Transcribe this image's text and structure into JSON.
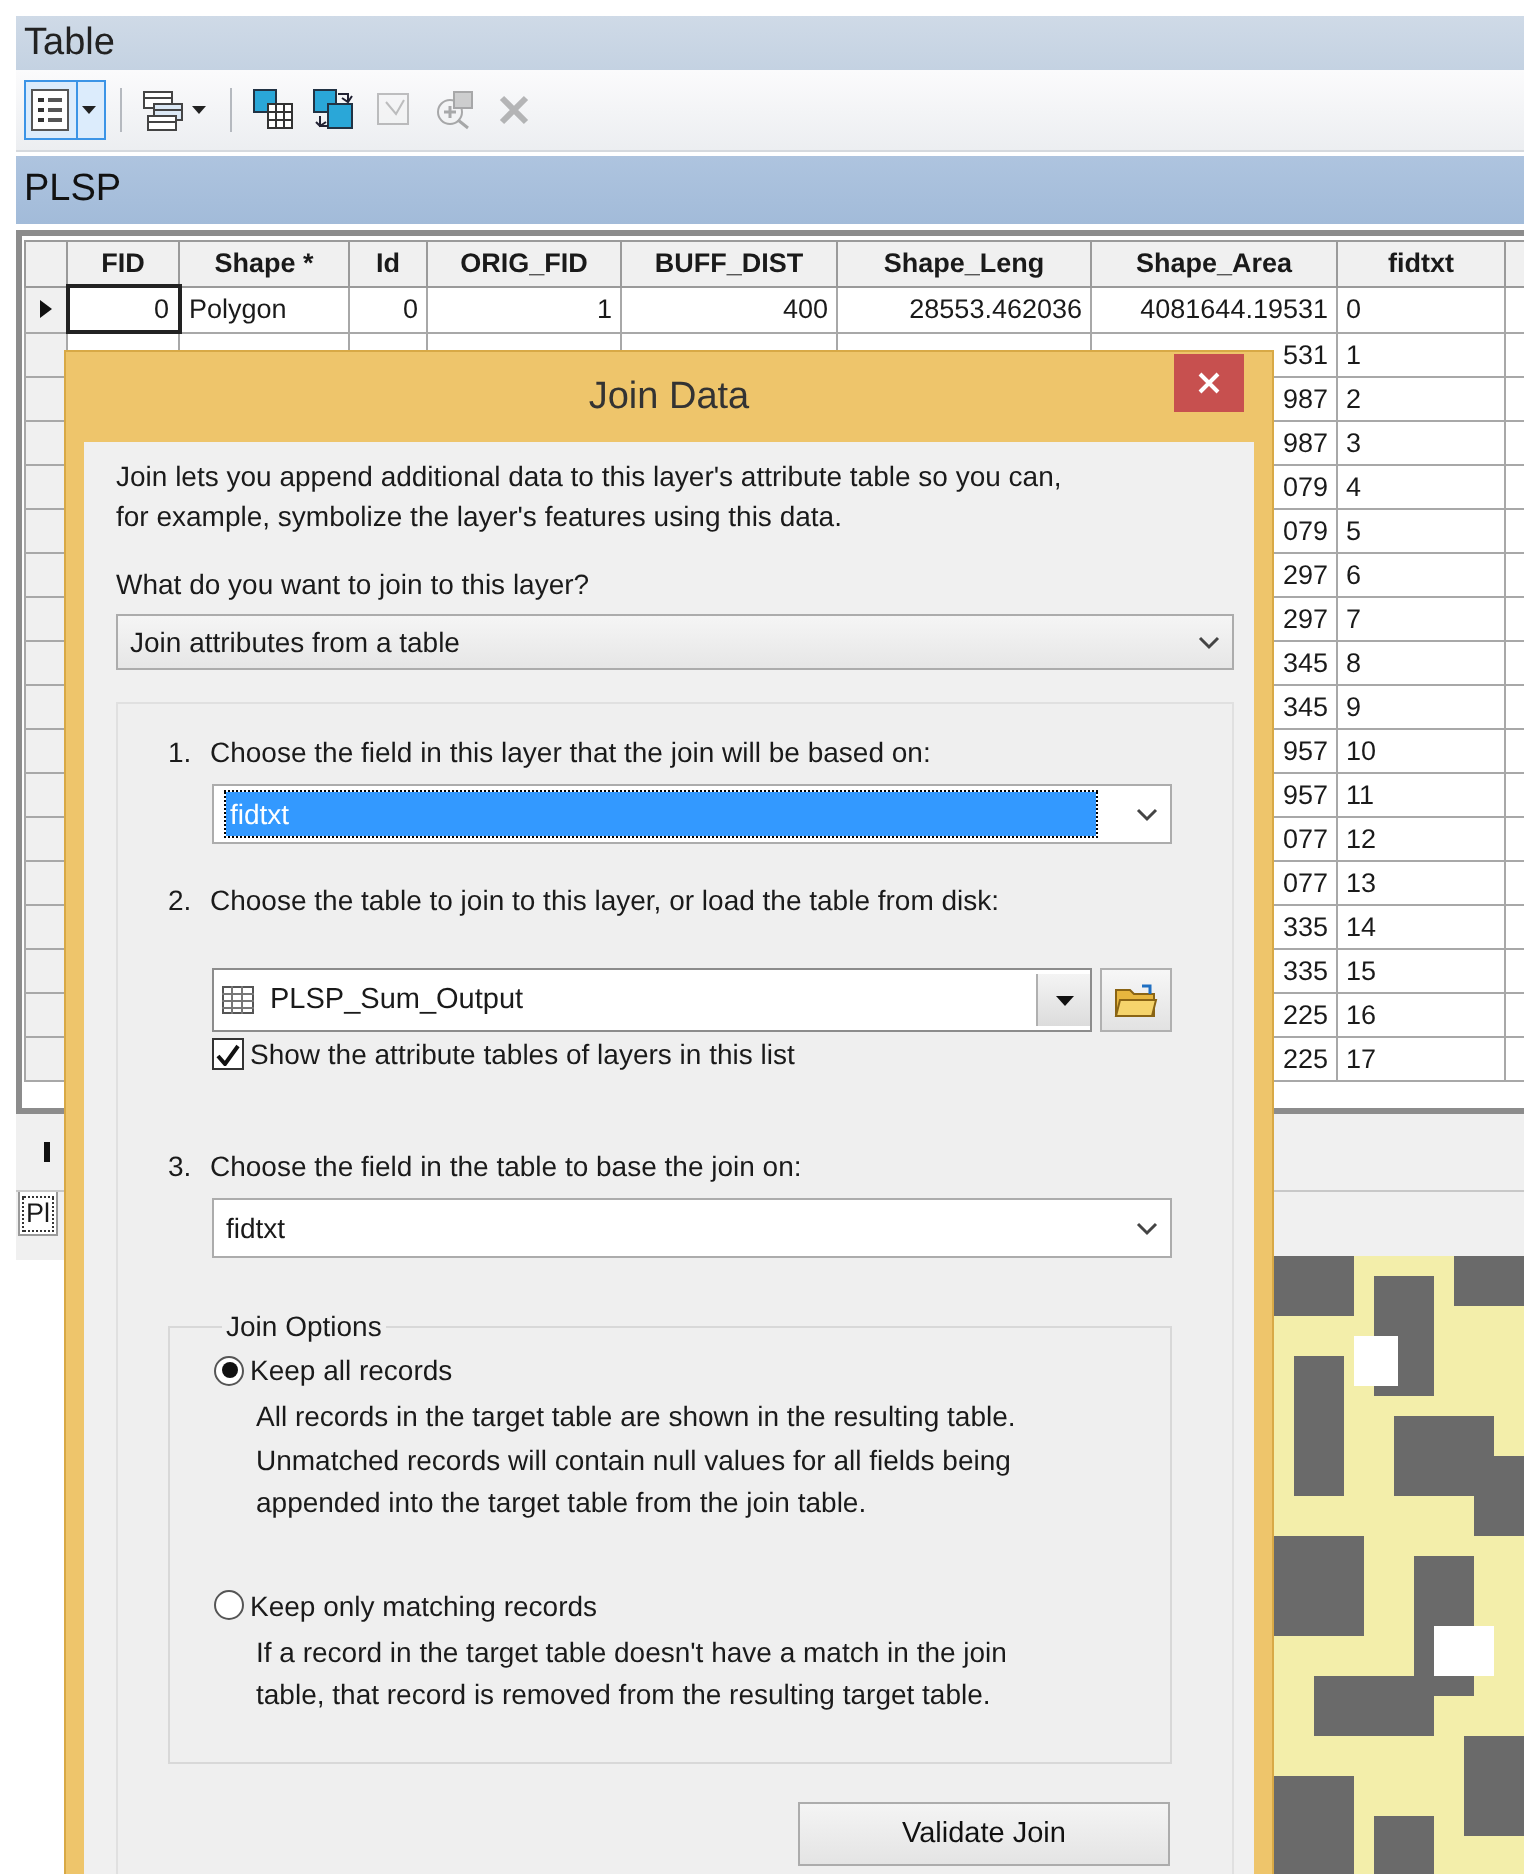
{
  "window": {
    "title": "Table"
  },
  "toolbar": [
    {
      "kind": "table-options",
      "dropdown": true,
      "selected": true,
      "disabled": false
    },
    {
      "kind": "relate",
      "dropdown": true,
      "selected": false,
      "disabled": false
    },
    {
      "kind": "select-by",
      "dropdown": false,
      "selected": false,
      "disabled": false
    },
    {
      "kind": "switch-selection",
      "dropdown": false,
      "selected": false,
      "disabled": false
    },
    {
      "kind": "clear-selection",
      "dropdown": false,
      "selected": false,
      "disabled": true
    },
    {
      "kind": "zoom-selected",
      "dropdown": false,
      "selected": false,
      "disabled": true
    },
    {
      "kind": "delete",
      "dropdown": false,
      "selected": false,
      "disabled": true
    }
  ],
  "layer_title": "PLSP",
  "table": {
    "columns": [
      {
        "name": "FID",
        "kind": "number"
      },
      {
        "name": "Shape *",
        "kind": "text"
      },
      {
        "name": "Id",
        "kind": "number"
      },
      {
        "name": "ORIG_FID",
        "kind": "number"
      },
      {
        "name": "BUFF_DIST",
        "kind": "number"
      },
      {
        "name": "Shape_Leng",
        "kind": "number"
      },
      {
        "name": "Shape_Area",
        "kind": "number"
      },
      {
        "name": "fidtxt",
        "kind": "text"
      }
    ],
    "rows": [
      {
        "current": true,
        "cells": [
          "0",
          "Polygon",
          "0",
          "1",
          "400",
          "28553.462036",
          "4081644.19531",
          "0"
        ]
      },
      {
        "current": false,
        "shape_area": "531",
        "fidtxt": "1"
      },
      {
        "current": false,
        "shape_area": "987",
        "fidtxt": "2"
      },
      {
        "current": false,
        "shape_area": "987",
        "fidtxt": "3"
      },
      {
        "current": false,
        "shape_area": "079",
        "fidtxt": "4"
      },
      {
        "current": false,
        "shape_area": "079",
        "fidtxt": "5"
      },
      {
        "current": false,
        "shape_area": "297",
        "fidtxt": "6"
      },
      {
        "current": false,
        "shape_area": "297",
        "fidtxt": "7"
      },
      {
        "current": false,
        "shape_area": "345",
        "fidtxt": "8"
      },
      {
        "current": false,
        "shape_area": "345",
        "fidtxt": "9"
      },
      {
        "current": false,
        "shape_area": "957",
        "fidtxt": "10"
      },
      {
        "current": false,
        "shape_area": "957",
        "fidtxt": "11"
      },
      {
        "current": false,
        "shape_area": "077",
        "fidtxt": "12"
      },
      {
        "current": false,
        "shape_area": "077",
        "fidtxt": "13"
      },
      {
        "current": false,
        "shape_area": "335",
        "fidtxt": "14"
      },
      {
        "current": false,
        "shape_area": "335",
        "fidtxt": "15"
      },
      {
        "current": false,
        "shape_area": "225",
        "fidtxt": "16"
      },
      {
        "current": false,
        "shape_area": "225",
        "fidtxt": "17"
      }
    ]
  },
  "table_tab": {
    "label": "Pl"
  },
  "dialog": {
    "title": "Join Data",
    "description": "Join lets you append additional data to this layer's attribute table so you can,\nfor example, symbolize the layer's features using this data.",
    "question": "What do you want to join to this layer?",
    "join_type": "Join attributes from a table",
    "steps": [
      {
        "number": "1.",
        "label": "Choose the field in this layer that the join will be based on:",
        "kind": "field",
        "value": "fidtxt",
        "highlighted": true
      },
      {
        "number": "2.",
        "label": "Choose the table to join to this layer, or load the table from disk:",
        "kind": "table",
        "value": "PLSP_Sum_Output",
        "checkbox": {
          "label": "Show the attribute tables of layers in this list",
          "checked": true
        }
      },
      {
        "number": "3.",
        "label": "Choose the field in the table to base the join on:",
        "kind": "field",
        "value": "fidtxt",
        "highlighted": false
      }
    ],
    "options": {
      "legend": "Join Options",
      "items": [
        {
          "label": "Keep all records",
          "selected": true,
          "description": "All records in the target table are shown in the resulting table.\nUnmatched records will contain null values for all fields being\nappended into the target table from the join table."
        },
        {
          "label": "Keep only matching records",
          "selected": false,
          "description": "If a record in the target table doesn't have a match in the join\ntable, that record is removed from the resulting target table."
        }
      ]
    },
    "buttons": [
      "Validate Join"
    ]
  }
}
